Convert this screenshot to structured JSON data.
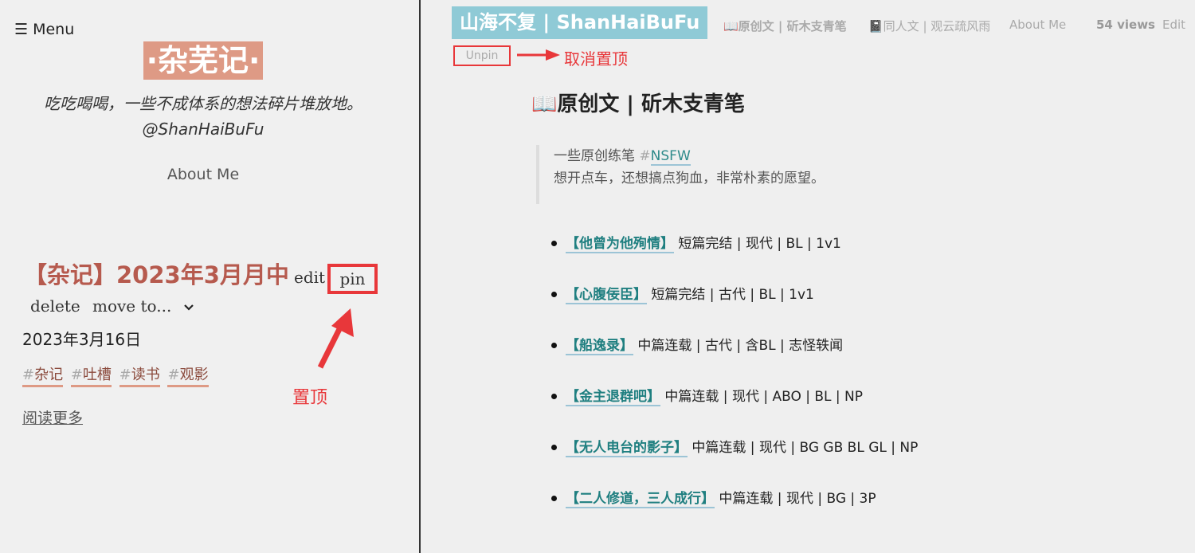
{
  "left": {
    "menu_label": "☰ Menu",
    "site_title": "·杂芜记·",
    "tagline": "吃吃喝喝，一些不成体系的想法碎片堆放地。",
    "tagline_handle": "@ShanHaiBuFu",
    "about": "About Me",
    "post": {
      "title": "【杂记】2023年3月月中",
      "edit": "edit",
      "pin": "pin",
      "delete": "delete",
      "move": "move to...",
      "date": "2023年3月16日",
      "tags": [
        "杂记",
        "吐槽",
        "读书",
        "观影"
      ],
      "read_more": "阅读更多"
    },
    "annotation_pin": "置顶"
  },
  "right": {
    "brand": "山海不复 | ShanHaiBuFu",
    "nav": {
      "item1": "📖原创文 | 斫木支青笔",
      "item2": "📓同人文 | 观云疏风雨",
      "about": "About Me",
      "views": "54 views",
      "edit": "Edit"
    },
    "unpin": "Unpin",
    "annotation_unpin": "取消置顶",
    "heading": "📖原创文 | 斫木支青笔",
    "quote": {
      "line1_text": "一些原创练笔 ",
      "hash": "#",
      "tag": "NSFW",
      "line2": "想开点车，还想搞点狗血，非常朴素的愿望。"
    },
    "stories": [
      {
        "title": "【他曾为他殉情】",
        "meta": "短篇完结 | 现代 | BL | 1v1"
      },
      {
        "title": "【心腹佞臣】",
        "meta": "短篇完结 | 古代 | BL | 1v1"
      },
      {
        "title": "【船逸录】",
        "meta": "中篇连载 | 古代 | 含BL | 志怪轶闻"
      },
      {
        "title": "【金主退群吧】",
        "meta": "中篇连载 | 现代 | ABO | BL | NP"
      },
      {
        "title": "【无人电台的影子】",
        "meta": "中篇连载 | 现代 | BG GB BL GL | NP"
      },
      {
        "title": "【二人修道，三人成行】",
        "meta": "中篇连载 | 现代 | BG | 3P"
      }
    ]
  },
  "colors": {
    "accent_red": "#e8373a",
    "title_bg": "#de9a85",
    "brand_bg": "#8fcad6",
    "link_teal": "#1f7f80",
    "post_title": "#b65a4e"
  }
}
